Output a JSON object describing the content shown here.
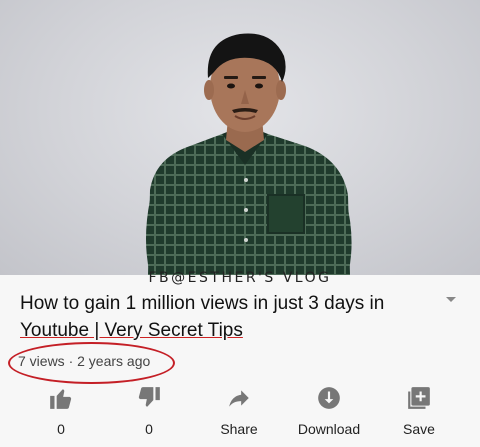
{
  "video": {
    "watermark": "FB@ESTHER'S VLOG"
  },
  "title": {
    "line1": "How to gain 1 million views in just 3 days in",
    "line2": "Youtube | Very Secret Tips"
  },
  "meta": {
    "text": "7 views · 2 years ago",
    "highlight_color": "#c41f26"
  },
  "actions": [
    {
      "icon": "thumbs-up-icon",
      "label": "0"
    },
    {
      "icon": "thumbs-down-icon",
      "label": "0"
    },
    {
      "icon": "share-arrow-icon",
      "label": "Share"
    },
    {
      "icon": "download-icon",
      "label": "Download"
    },
    {
      "icon": "add-to-playlist-icon",
      "label": "Save"
    }
  ],
  "colors": {
    "icon": "#777777",
    "background": "#f7f7f7"
  }
}
